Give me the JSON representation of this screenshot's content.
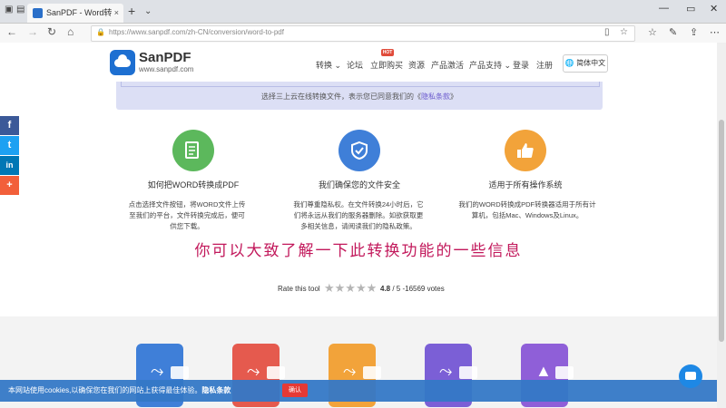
{
  "browser": {
    "tab_title": "SanPDF - Word转PDF - ",
    "tab_close": "×",
    "new_tab": "+",
    "tab_menu": "⌄",
    "url": "https://www.sanpdf.com/zh-CN/conversion/word-to-pdf",
    "window_controls": [
      "—",
      "▭",
      "✕"
    ]
  },
  "site": {
    "brand": "SanPDF",
    "brand_url": "www.sanpdf.com",
    "nav": [
      "转换 ⌄",
      "论坛",
      "立即购买",
      "资源",
      "产品激活",
      "产品支持 ⌄",
      "登录",
      "注册"
    ],
    "hot_badge": "HOT",
    "language": "简体中文"
  },
  "banner": {
    "text": "选择三上云在线转换文件，表示您已同意我们的《",
    "link": "隐私条款",
    "text_end": "》"
  },
  "features": [
    {
      "title": "如何把WORD转换成PDF",
      "desc": "点击选择文件按钮，将WORD文件上传至我们的平台，文件转换完成后，便可供您下载。",
      "color": "#5cb85c"
    },
    {
      "title": "我们确保您的文件安全",
      "desc": "我们尊重隐私权。在文件转换24小时后，它们将永远从我们的服务器删除。如欲获取更多相关信息，请阅读我们的隐私政策。",
      "color": "#3f7fd8"
    },
    {
      "title": "适用于所有操作系统",
      "desc": "我们的WORD转换成PDF转换器适用于所有计算机，包括Mac、Windows及Linux。",
      "color": "#f2a33a"
    }
  ],
  "overlay_caption": "你可以大致了解一下此转换功能的一些信息",
  "rating": {
    "label": "Rate this tool",
    "stars": "★★★★★",
    "score": "4.8",
    "detail": " / 5 -16569  votes"
  },
  "file_icon_colors": [
    "#3f7fd8",
    "#e55a4e",
    "#f2a33a",
    "#7b5fd6",
    "#8f5fd8"
  ],
  "cookie": {
    "text": "本网站使用cookies,以确保您在我们的网站上获得最佳体验。",
    "link": "隐私条款",
    "ok": "确认"
  },
  "share": [
    "f",
    "t",
    "in",
    "+"
  ]
}
